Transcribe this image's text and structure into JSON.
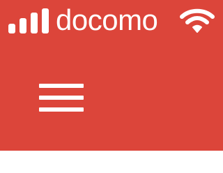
{
  "status_bar": {
    "signal_icon": "signal-strength-icon",
    "signal_bars": 4,
    "carrier": "docomo",
    "wifi_icon": "wifi-icon"
  },
  "header": {
    "menu_icon": "hamburger-menu-icon"
  },
  "colors": {
    "header_background": "#dc453a",
    "status_foreground": "#ffffff",
    "content_background": "#ffffff"
  }
}
